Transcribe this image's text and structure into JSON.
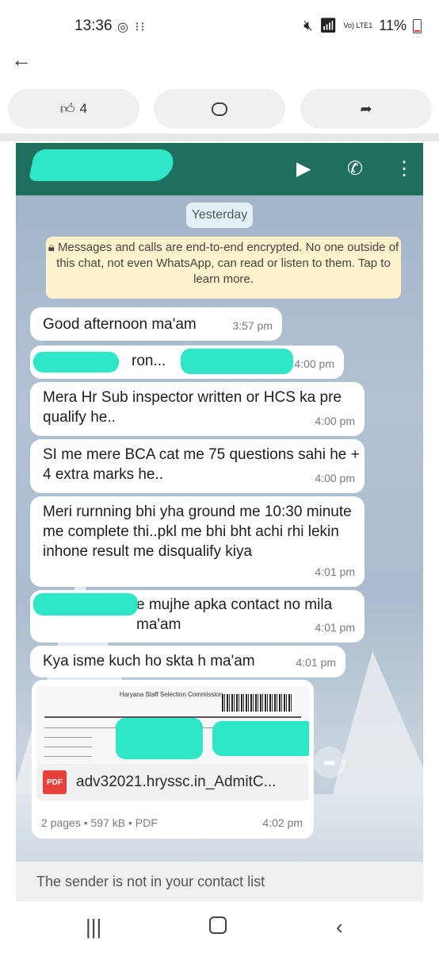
{
  "status_bar": {
    "time": "13:36",
    "left_icons": "◎ ⁝⁝",
    "network": "Vo) LTE1",
    "battery": "11%"
  },
  "post_actions": {
    "like_count": "4"
  },
  "whatsapp": {
    "day_label": "Yesterday",
    "encryption_notice": "Messages and calls are end-to-end encrypted. No one outside of this chat, not even WhatsApp, can read or listen to them. Tap to learn more.",
    "messages": [
      {
        "text": "Good afternoon ma'am",
        "time": "3:57 pm"
      },
      {
        "text": "ron...",
        "time": "4:00 pm"
      },
      {
        "text": "Mera Hr Sub inspector written or HCS ka pre qualify he..",
        "time": "4:00 pm"
      },
      {
        "text": "SI me mere BCA cat me 75 questions sahi he + 4 extra marks he..",
        "time": "4:00 pm"
      },
      {
        "text": "Meri rurnning bhi yha ground me 10:30 minute me complete thi..pkl me bhi bht achi rhi lekin inhone result me disqualify kiya",
        "time": "4:01 pm"
      },
      {
        "text": "e mujhe apka contact no mila ma'am",
        "time": "4:01 pm"
      },
      {
        "text": "Kya isme kuch ho skta h ma'am",
        "time": "4:01 pm"
      }
    ],
    "document": {
      "preview_title": "Haryana Staff Selection Commission",
      "file_name": "adv32021.hryssc.in_AdmitC...",
      "meta": "2 pages • 597 kB • PDF",
      "time": "4:02 pm",
      "type_badge": "PDF"
    },
    "sender_notice": "The sender is not in your contact list"
  }
}
